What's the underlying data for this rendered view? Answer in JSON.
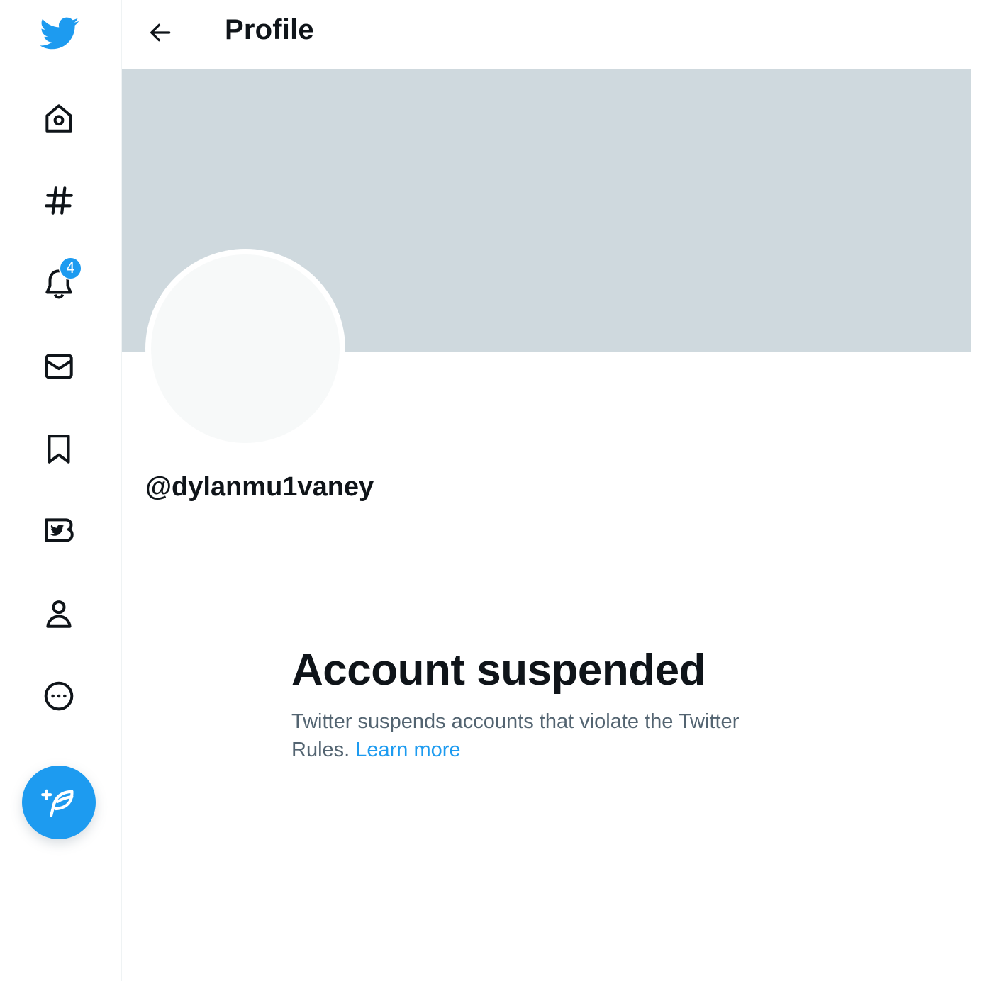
{
  "app": {
    "name": "Twitter",
    "accent_color": "#1d9bf0"
  },
  "sidebar": {
    "items": [
      {
        "name": "home",
        "icon": "home-icon"
      },
      {
        "name": "explore",
        "icon": "hashtag-icon"
      },
      {
        "name": "notifications",
        "icon": "bell-icon",
        "badge": "4"
      },
      {
        "name": "messages",
        "icon": "envelope-icon"
      },
      {
        "name": "bookmarks",
        "icon": "bookmark-icon"
      },
      {
        "name": "twitter-blue",
        "icon": "twitter-blue-icon"
      },
      {
        "name": "profile",
        "icon": "person-icon"
      },
      {
        "name": "more",
        "icon": "more-circle-icon"
      }
    ],
    "compose_icon": "compose-feather-icon"
  },
  "header": {
    "title": "Profile",
    "back_icon": "arrow-left-icon"
  },
  "profile": {
    "handle": "@dylanmu1vaney",
    "banner_color": "#cfd9de"
  },
  "suspension": {
    "title": "Account suspended",
    "description": "Twitter suspends accounts that violate the Twitter Rules.",
    "link_label": "Learn more"
  }
}
